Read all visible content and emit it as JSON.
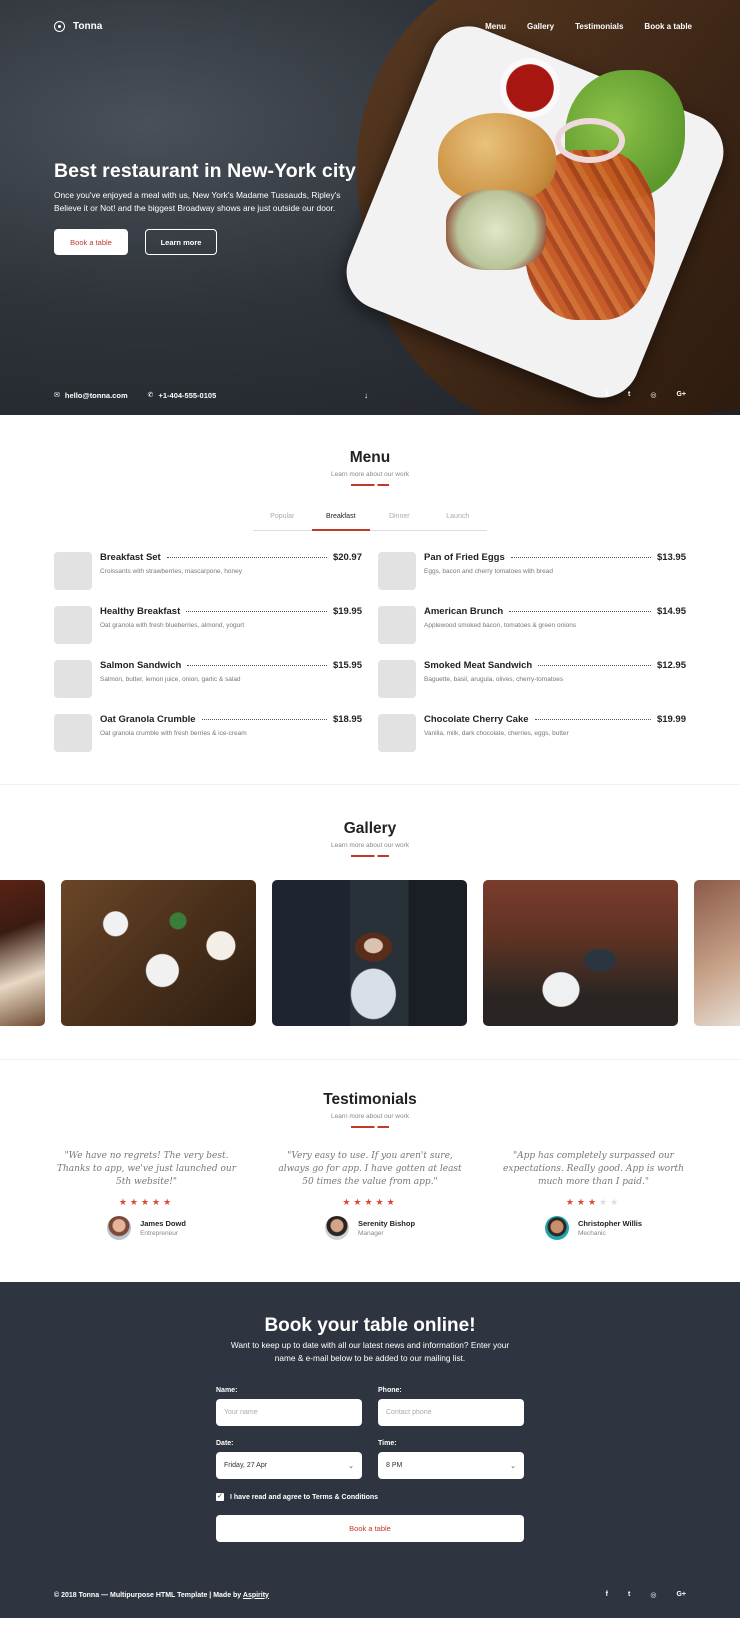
{
  "nav": {
    "brand": "Tonna",
    "links": [
      "Menu",
      "Gallery",
      "Testimonials",
      "Book a table"
    ]
  },
  "hero": {
    "title": "Best restaurant in New-York city",
    "subtitle": "Once you've enjoyed a meal with us, New York's Madame Tussauds, Ripley's Believe it or Not! and the biggest Broadway shows are just outside our door.",
    "primary_button": "Book a table",
    "secondary_button": "Learn more",
    "email": "hello@tonna.com",
    "phone": "+1-404-555-0105",
    "socials": [
      "f",
      "t",
      "◎",
      "G+"
    ]
  },
  "menu": {
    "title": "Menu",
    "subtitle": "Learn more about our work",
    "tabs": [
      "Popular",
      "Breakfast",
      "Dinner",
      "Launch"
    ],
    "active_tab": "Breakfast",
    "items": [
      {
        "name": "Breakfast Set",
        "desc": "Croissants with strawberries, mascarpone, honey",
        "price": "$20.97"
      },
      {
        "name": "Pan of Fried Eggs",
        "desc": "Eggs, bacon and cherry tomatoes with bread",
        "price": "$13.95"
      },
      {
        "name": "Healthy Breakfast",
        "desc": "Oat granola with fresh blueberries, almond, yogurt",
        "price": "$19.95"
      },
      {
        "name": "American Brunch",
        "desc": "Applewood smoked bacon, tomatoes & green onions",
        "price": "$14.95"
      },
      {
        "name": "Salmon Sandwich",
        "desc": "Salmon, butter, lemon juice, onion, garlic & salad",
        "price": "$15.95"
      },
      {
        "name": "Smoked Meat Sandwich",
        "desc": "Baguette, basil, arugula, olives, cherry-tomatoes",
        "price": "$12.95"
      },
      {
        "name": "Oat Granola Crumble",
        "desc": "Oat granola crumble with fresh berries & ice-cream",
        "price": "$18.95"
      },
      {
        "name": "Chocolate Cherry Cake",
        "desc": "Vanilla, milk, dark chocolate, cherries, eggs, butter",
        "price": "$19.99"
      }
    ]
  },
  "gallery": {
    "title": "Gallery",
    "subtitle": "Learn more about our work"
  },
  "testimonials": {
    "title": "Testimonials",
    "subtitle": "Learn more about our work",
    "items": [
      {
        "quote": "\"We have no regrets! The very best. Thanks to app, we've just launched our 5th website!\"",
        "rating": 5,
        "name": "James Dowd",
        "role": "Entrepreneur"
      },
      {
        "quote": "\"Very easy to use. If you aren't sure, always go for app. I have gotten at least 50 times the value from app.\"",
        "rating": 5,
        "name": "Serenity Bishop",
        "role": "Manager"
      },
      {
        "quote": "\"App has completely surpassed our expectations. Really good. App is worth much more than I paid.\"",
        "rating": 3,
        "name": "Christopher Willis",
        "role": "Mechanic"
      }
    ]
  },
  "booking": {
    "title": "Book your table online!",
    "subtitle": "Want to keep up to date with all our latest news and information? Enter your name & e-mail below to be added to our mailing list.",
    "name_label": "Name:",
    "name_placeholder": "Your name",
    "phone_label": "Phone:",
    "phone_placeholder": "Contact phone",
    "date_label": "Date:",
    "date_value": "Friday, 27 Apr",
    "time_label": "Time:",
    "time_value": "8 PM",
    "agree_text": "I have read and agree to Terms & Conditions",
    "agree_checked": true,
    "submit_label": "Book a table"
  },
  "footer": {
    "copyright": "© 2018 Tonna — Multipurpose HTML Template | Made by ",
    "author": "Aspirity",
    "socials": [
      "f",
      "t",
      "◎",
      "G+"
    ]
  },
  "colors": {
    "accent": "#c0392b",
    "dark_bg": "#2f3540",
    "thumb": "#e2e2e2"
  }
}
